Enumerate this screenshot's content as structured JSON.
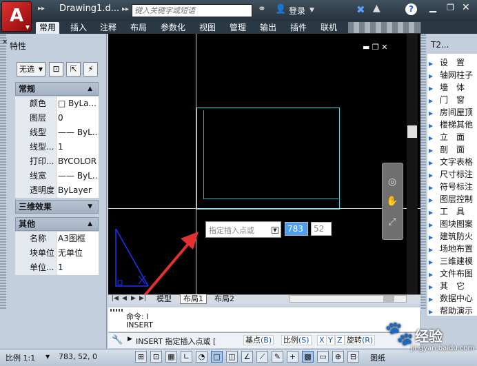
{
  "titlebar": {
    "doc_title": "Drawing1.d...",
    "search_placeholder": "键入关键字或短语",
    "login": "登录",
    "help": "?",
    "qa_more": "▸▸",
    "title_more": "▸▸"
  },
  "ribbon_tabs": [
    "常用",
    "插入",
    "注释",
    "布局",
    "参数化",
    "视图",
    "管理",
    "输出",
    "插件",
    "联机"
  ],
  "active_tab_index": 0,
  "properties_panel": {
    "title": "特性",
    "selection": "无选",
    "sections": {
      "general": "常规",
      "3d": "三维效果",
      "misc": "其他"
    },
    "general_rows": [
      {
        "label": "颜色",
        "value": "□ ByLa..."
      },
      {
        "label": "图层",
        "value": "0"
      },
      {
        "label": "线型",
        "value": "—— ByL..."
      },
      {
        "label": "线型...",
        "value": "1"
      },
      {
        "label": "打印...",
        "value": "BYCOLOR"
      },
      {
        "label": "线宽",
        "value": "—— ByL..."
      },
      {
        "label": "透明度",
        "value": "ByLayer"
      }
    ],
    "misc_rows": [
      {
        "label": "名称",
        "value": "A3图框"
      },
      {
        "label": "块单位",
        "value": "无单位"
      },
      {
        "label": "单位...",
        "value": "1"
      }
    ]
  },
  "canvas": {
    "tooltip_prompt": "指定插入点或",
    "dyn_x": "783",
    "dyn_y": "52",
    "bg_color": "#000000",
    "frame_color": "#4fd4e4"
  },
  "layout_tabs": [
    "模型",
    "布局1",
    "布局2"
  ],
  "active_layout_index": 1,
  "command": {
    "history": [
      "命令: I",
      "INSERT"
    ],
    "prompt": "INSERT 指定插入点或 [",
    "options": [
      {
        "label": "基点",
        "key": "(B)"
      },
      {
        "label": "比例",
        "key": "(S)"
      },
      {
        "label": "",
        "key": "X"
      },
      {
        "label": "",
        "key": "Y"
      },
      {
        "label": "",
        "key": "Z"
      },
      {
        "label": "旋转",
        "key": "(R)"
      }
    ]
  },
  "tool_palette": {
    "title": "T2...",
    "items": [
      "设　置",
      "轴网柱子",
      "墙　体",
      "门　窗",
      "房间屋顶",
      "楼梯其他",
      "立　面",
      "剖　面",
      "文字表格",
      "尺寸标注",
      "符号标注",
      "图层控制",
      "工　具",
      "图块图案",
      "建筑防火",
      "场地布置",
      "三维建模",
      "文件布图",
      "其　它",
      "数据中心",
      "帮助演示"
    ]
  },
  "statusbar": {
    "scale": "比例 1:1",
    "coords": "783, 52, 0",
    "model": "图纸"
  },
  "watermark": {
    "text": "经验",
    "sub": "jingyan.baidu.com"
  }
}
